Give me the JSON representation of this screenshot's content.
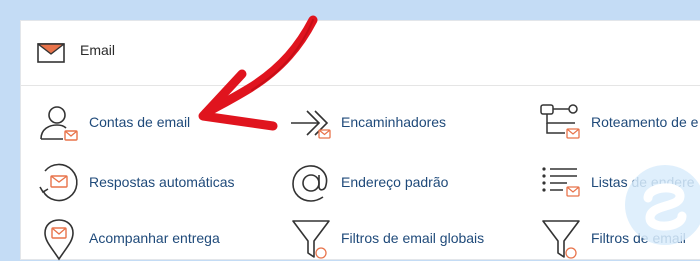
{
  "section": {
    "title": "Email",
    "icon": "envelope-icon"
  },
  "items": [
    {
      "label": "Contas de email",
      "icon": "user-envelope-icon"
    },
    {
      "label": "Encaminhadores",
      "icon": "forward-arrow-icon"
    },
    {
      "label": "Roteamento de e",
      "icon": "routing-icon"
    },
    {
      "label": "Respostas automáticas",
      "icon": "auto-reply-icon"
    },
    {
      "label": "Endereço padrão",
      "icon": "at-sign-icon"
    },
    {
      "label": "Listas de endere",
      "icon": "address-list-icon"
    },
    {
      "label": "Acompanhar entrega",
      "icon": "location-pin-icon"
    },
    {
      "label": "Filtros de email globais",
      "icon": "filter-icon"
    },
    {
      "label": "Filtros de email",
      "icon": "filter-icon"
    }
  ],
  "colors": {
    "accent": "#e8734a",
    "link": "#1f4a7a",
    "annotation_arrow": "#e0141e",
    "background": "#c4dcf5"
  }
}
